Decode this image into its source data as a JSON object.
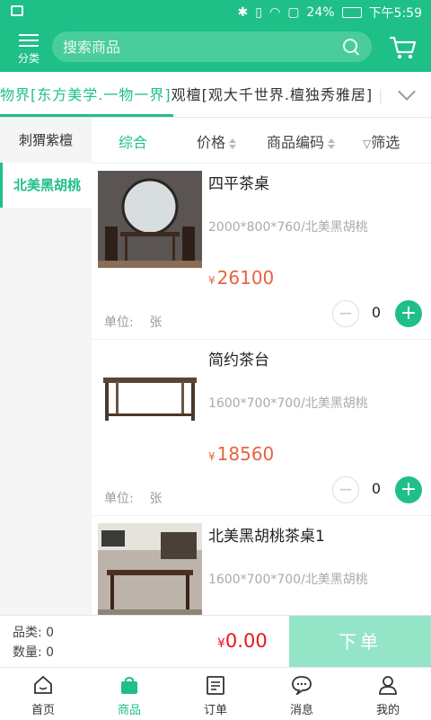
{
  "status_bar": {
    "battery": "24%",
    "time": "下午5:59"
  },
  "header": {
    "menu_label": "分类",
    "search_placeholder": "搜索商品"
  },
  "brand_tabs": {
    "active": "物界[东方美学.一物一界]",
    "rest": "观檀[观大千世界.檀独秀雅居]",
    "separator": "|"
  },
  "sidebar": {
    "items": [
      {
        "label": "刺猬紫檀"
      },
      {
        "label": "北美黑胡桃"
      }
    ]
  },
  "sort_bar": {
    "items": [
      "综合",
      "价格",
      "商品编码",
      "筛选"
    ]
  },
  "products": [
    {
      "name": "四平茶桌",
      "spec": "2000*800*760/北美黑胡桃",
      "currency": "¥",
      "price": "26100",
      "unit_label": "单位:",
      "unit": "张",
      "qty": "0"
    },
    {
      "name": "简约茶台",
      "spec": "1600*700*700/北美黑胡桃",
      "currency": "¥",
      "price": "18560",
      "unit_label": "单位:",
      "unit": "张",
      "qty": "0"
    },
    {
      "name": "北美黑胡桃茶桌1",
      "spec": "1600*700*700/北美黑胡桃",
      "currency": "",
      "price": "",
      "unit_label": "",
      "unit": "",
      "qty": ""
    }
  ],
  "cart_bar": {
    "category_label": "品类:",
    "category_count": "0",
    "quantity_label": "数量:",
    "quantity_count": "0",
    "currency": "¥",
    "total": "0.00",
    "order_label": "下单"
  },
  "tab_bar": {
    "items": [
      {
        "label": "首页"
      },
      {
        "label": "商品"
      },
      {
        "label": "订单"
      },
      {
        "label": "消息"
      },
      {
        "label": "我的"
      }
    ]
  },
  "colors": {
    "primary": "#1fbf88",
    "price": "#e8623d",
    "total": "#e8161d",
    "order_button": "#94e5c8"
  }
}
